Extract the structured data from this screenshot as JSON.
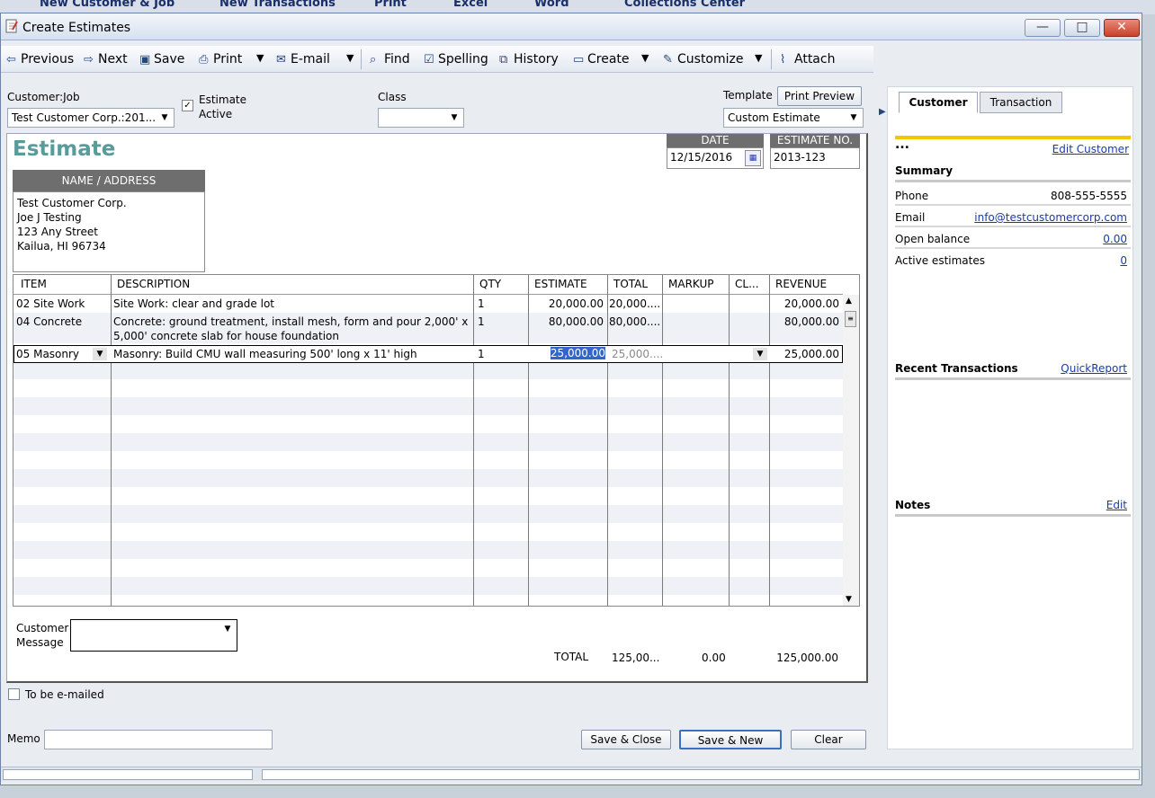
{
  "topstrip": {
    "items": [
      "New Customer & Job",
      "New Transactions",
      "Print",
      "Excel",
      "Word",
      "Collections Center"
    ]
  },
  "window": {
    "title": "Create Estimates",
    "controls": [
      "—",
      "□",
      "✕"
    ]
  },
  "toolbar": {
    "previous": "Previous",
    "next": "Next",
    "save": "Save",
    "print": "Print",
    "email": "E-mail",
    "find": "Find",
    "spelling": "Spelling",
    "history": "History",
    "create": "Create",
    "customize": "Customize",
    "attach": "Attach"
  },
  "header": {
    "customer_job_label": "Customer:Job",
    "customer_job_value": "Test Customer Corp.:201...",
    "estimate_active_label_1": "Estimate",
    "estimate_active_label_2": "Active",
    "estimate_active_checked": true,
    "class_label": "Class",
    "class_value": "",
    "template_label": "Template",
    "print_preview": "Print Preview",
    "template_value": "Custom Estimate"
  },
  "estimate": {
    "title": "Estimate",
    "date_label": "DATE",
    "date_value": "12/15/2016",
    "number_label": "ESTIMATE NO.",
    "number_value": "2013-123",
    "name_address_label": "NAME / ADDRESS",
    "address_lines": [
      "Test Customer Corp.",
      "Joe J Testing",
      "123 Any Street",
      "Kailua, HI 96734"
    ]
  },
  "table": {
    "headers": [
      "ITEM",
      "DESCRIPTION",
      "QTY",
      "ESTIMATE",
      "TOTAL",
      "MARKUP",
      "CL...",
      "REVENUE"
    ],
    "rows": [
      {
        "item": "02 Site Work",
        "desc1": "Site Work: clear and grade lot",
        "desc2": "",
        "qty": "1",
        "estimate": "20,000.00",
        "total": "20,000....",
        "markup": "",
        "class": "",
        "revenue": "20,000.00"
      },
      {
        "item": "04 Concrete",
        "desc1": "Concrete: ground treatment, install mesh, form and pour 2,000' x",
        "desc2": "5,000' concrete slab for house foundation",
        "qty": "1",
        "estimate": "80,000.00",
        "total": "80,000....",
        "markup": "",
        "class": "",
        "revenue": "80,000.00"
      },
      {
        "item": "05 Masonry",
        "desc1": "Masonry:  Build CMU wall measuring 500' long x 11' high",
        "desc2": "",
        "qty": "1",
        "estimate": "25,000.00",
        "total": "25,000....",
        "markup": "",
        "class": "",
        "revenue": "25,000.00"
      }
    ]
  },
  "footer": {
    "customer_message_label_1": "Customer",
    "customer_message_label_2": "Message",
    "total_label": "TOTAL",
    "total_value": "125,00...",
    "markup_total": "0.00",
    "revenue_total": "125,000.00",
    "to_be_emailed": "To be e-mailed",
    "memo_label": "Memo",
    "save_close": "Save & Close",
    "save_new": "Save & New",
    "clear": "Clear"
  },
  "panel": {
    "tab_customer": "Customer",
    "tab_transaction": "Transaction",
    "ellipsis": "...",
    "edit_customer": "Edit Customer",
    "summary": "Summary",
    "phone_label": "Phone",
    "phone_value": "808-555-5555",
    "email_label": "Email",
    "email_value": "info@testcustomercorp.com",
    "open_balance_label": "Open balance",
    "open_balance_value": "0.00",
    "active_estimates_label": "Active estimates",
    "active_estimates_value": "0",
    "recent_transactions": "Recent Transactions",
    "quickreport": "QuickReport",
    "notes": "Notes",
    "edit": "Edit"
  },
  "colors": {
    "estimate_title": "#5a9a9a",
    "header_box": "#6e6e6e",
    "panel_accent": "#f0c800",
    "link": "#1b3aa8",
    "selection": "#3366cc"
  }
}
